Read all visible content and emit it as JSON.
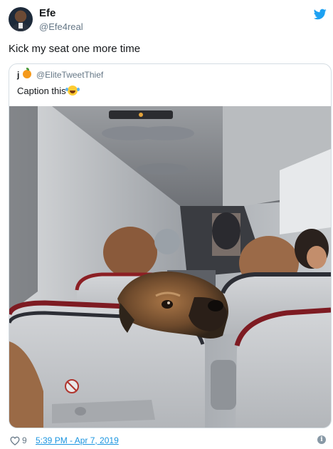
{
  "author": {
    "name": "Efe",
    "handle": "@Efe4real"
  },
  "tweet": {
    "text": "Kick my seat one more time"
  },
  "quoted": {
    "name": "j",
    "emoji": "orange-emoji",
    "handle": "@EliteTweetThief",
    "text": "Caption this",
    "text_emoji": "face-with-tears-of-joy-emoji"
  },
  "footer": {
    "likes": "9",
    "timestamp": "5:39 PM - Apr 7, 2019"
  },
  "colors": {
    "twitter_blue": "#1da1f2",
    "link_blue": "#1b95e0",
    "muted": "#657786",
    "border": "#d5dde3"
  }
}
